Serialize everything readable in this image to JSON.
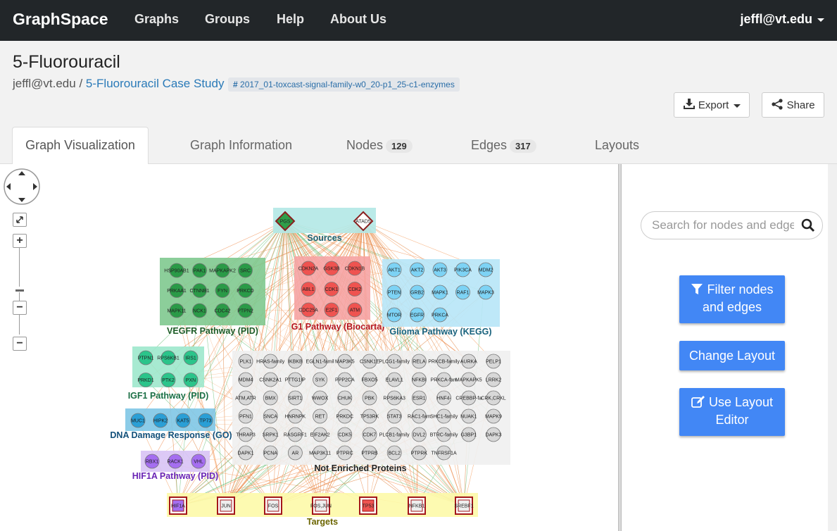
{
  "nav": {
    "brand": "GraphSpace",
    "items": [
      "Graphs",
      "Groups",
      "Help",
      "About Us"
    ],
    "user": "jeffl@vt.edu"
  },
  "header": {
    "title": "5-Fluorouracil",
    "owner": "jeffl@vt.edu",
    "separator": "/",
    "group": "5-Fluorouracil Case Study",
    "tag": "2017_01-toxcast-signal-family-w0_20-p1_25-c1-enzymes",
    "export_label": "Export",
    "share_label": "Share"
  },
  "tabs": [
    {
      "label": "Graph Visualization"
    },
    {
      "label": "Graph Information"
    },
    {
      "label": "Nodes",
      "count": "129"
    },
    {
      "label": "Edges",
      "count": "317"
    },
    {
      "label": "Layouts"
    }
  ],
  "sidebar": {
    "search_placeholder": "Search for nodes and edges",
    "filter_label_1": "Filter nodes",
    "filter_label_2": "and edges",
    "change_layout_label": "Change Layout",
    "layout_editor_label_1": "Use Layout",
    "layout_editor_label_2": "Editor"
  },
  "graph": {
    "groups": [
      {
        "label": "Sources",
        "fill": "#b2e8e6",
        "text": "#1f5d6b"
      },
      {
        "label": "VEGFR Pathway (PID)",
        "fill": "#7fc98f",
        "text": "#1c5b26"
      },
      {
        "label": "G1 Pathway (Biocarta)",
        "fill": "#f6a3a3",
        "text": "#b4141b"
      },
      {
        "label": "Glioma Pathway (KEGG)",
        "fill": "#b7e6f7",
        "text": "#17617c"
      },
      {
        "label": "IGF1 Pathway (PID)",
        "fill": "#9de8cc",
        "text": "#1b6f45"
      },
      {
        "label": "DNA Damage Response (GO)",
        "fill": "#7fc7e5",
        "text": "#12507a"
      },
      {
        "label": "HIF1A Pathway (PID)",
        "fill": "#d8c3f5",
        "text": "#6a24b5"
      },
      {
        "label": "Not Enriched Proteins",
        "fill": "#efefef",
        "text": "#222222"
      },
      {
        "label": "Targets",
        "fill": "#fdfaa8",
        "text": "#6b6500"
      }
    ],
    "sources": [
      "PGS",
      "ATAD5"
    ],
    "vegfr": [
      "HSP90AB1",
      "PAK1",
      "MAPKAPK2",
      "SRC",
      "PRKAA1",
      "CTNNB1",
      "FYN",
      "PRKCD",
      "MAPK11",
      "NCK1",
      "CDC42",
      "PTPN2"
    ],
    "g1": [
      "CDKN2A",
      "GSK3B",
      "CDKN1B",
      "ABL1",
      "CDK1",
      "CDK2",
      "CDC25A",
      "E2F1",
      "ATM"
    ],
    "glioma": [
      "AKT1",
      "AKT2",
      "AKT3",
      "PIK3CA",
      "MDM2",
      "PTEN",
      "GRB2",
      "MAPK1",
      "RAF1",
      "MAPK3",
      "MTOR",
      "EGFR",
      "PRKCA"
    ],
    "igf1": [
      "PTPN1",
      "RPS6KB1",
      "IRS1",
      "PRKD1",
      "PTK2",
      "PXN"
    ],
    "dna": [
      "MUC1",
      "HIPK2",
      "KAT5",
      "TP73"
    ],
    "hif1a": [
      "RBX1",
      "RACK1",
      "VHL"
    ],
    "not_enriched": [
      [
        "PLK1",
        "HRAS-family",
        "IKBKB",
        "EGLN1-famil",
        "MAP3K5",
        "CSNK1E",
        "PLCG1-family",
        "RELA",
        "PRKCB-family",
        "AURKA",
        "PELP1"
      ],
      [
        "MDM4",
        "CSNK2A1",
        "PTTG1IP",
        "SYK",
        "PPP2CA",
        "FBXO5",
        "ELAVL1",
        "NFKBI",
        "PRKCA-fam",
        "MAPKAPK5",
        "LRRK2"
      ],
      [
        "ATM,ATR",
        "BMX",
        "SIRT1",
        "WWOX",
        "CHUK",
        "PBK",
        "RPS6KA3",
        "ESR1",
        "HNF4-",
        "CREBBP-fa",
        "CRK,CRKL"
      ],
      [
        "PFN1",
        "SNCA",
        "HNRNPK",
        "RET",
        "PRKDC",
        "TP53RK",
        "STAT3",
        "RAC1-fam",
        "SHC1-family",
        "NUAK1",
        "MAPK9"
      ],
      [
        "THRAP3",
        "SRPK1",
        "RASGRF1",
        "EIF2AK2",
        "CDK5",
        "CDK7",
        "PLCB1-family",
        "DVL2",
        "BTRC-family",
        "G3BP1",
        "DAPK3"
      ],
      [
        "DAPK1",
        "PCNA",
        "AR",
        "MAP3K11",
        "PTPRC",
        "PTPRB",
        "BCL2",
        "PTPRK",
        "TNFRSF1A"
      ]
    ],
    "targets": [
      "HIF1A",
      "JUN",
      "FOS",
      "FOS,JUN",
      "TP53",
      "NFKB1",
      "SREBF1"
    ]
  }
}
